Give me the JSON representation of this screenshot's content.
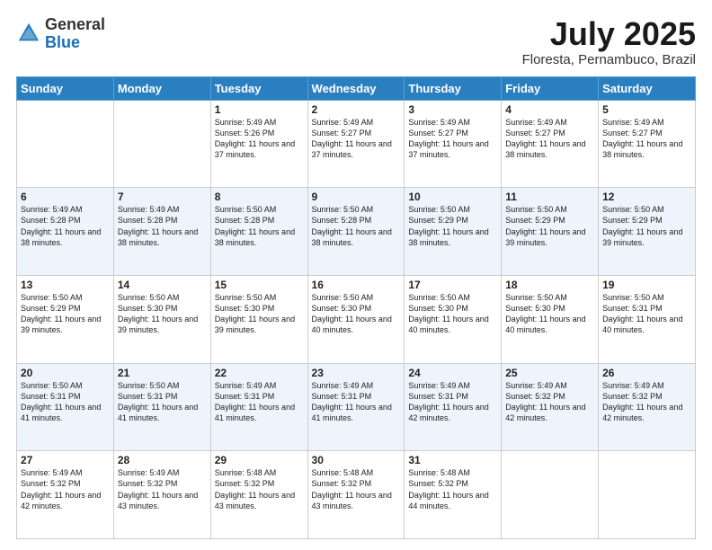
{
  "logo": {
    "general": "General",
    "blue": "Blue"
  },
  "header": {
    "title": "July 2025",
    "subtitle": "Floresta, Pernambuco, Brazil"
  },
  "days_of_week": [
    "Sunday",
    "Monday",
    "Tuesday",
    "Wednesday",
    "Thursday",
    "Friday",
    "Saturday"
  ],
  "weeks": [
    [
      {
        "day": "",
        "info": ""
      },
      {
        "day": "",
        "info": ""
      },
      {
        "day": "1",
        "info": "Sunrise: 5:49 AM\nSunset: 5:26 PM\nDaylight: 11 hours and 37 minutes."
      },
      {
        "day": "2",
        "info": "Sunrise: 5:49 AM\nSunset: 5:27 PM\nDaylight: 11 hours and 37 minutes."
      },
      {
        "day": "3",
        "info": "Sunrise: 5:49 AM\nSunset: 5:27 PM\nDaylight: 11 hours and 37 minutes."
      },
      {
        "day": "4",
        "info": "Sunrise: 5:49 AM\nSunset: 5:27 PM\nDaylight: 11 hours and 38 minutes."
      },
      {
        "day": "5",
        "info": "Sunrise: 5:49 AM\nSunset: 5:27 PM\nDaylight: 11 hours and 38 minutes."
      }
    ],
    [
      {
        "day": "6",
        "info": "Sunrise: 5:49 AM\nSunset: 5:28 PM\nDaylight: 11 hours and 38 minutes."
      },
      {
        "day": "7",
        "info": "Sunrise: 5:49 AM\nSunset: 5:28 PM\nDaylight: 11 hours and 38 minutes."
      },
      {
        "day": "8",
        "info": "Sunrise: 5:50 AM\nSunset: 5:28 PM\nDaylight: 11 hours and 38 minutes."
      },
      {
        "day": "9",
        "info": "Sunrise: 5:50 AM\nSunset: 5:28 PM\nDaylight: 11 hours and 38 minutes."
      },
      {
        "day": "10",
        "info": "Sunrise: 5:50 AM\nSunset: 5:29 PM\nDaylight: 11 hours and 38 minutes."
      },
      {
        "day": "11",
        "info": "Sunrise: 5:50 AM\nSunset: 5:29 PM\nDaylight: 11 hours and 39 minutes."
      },
      {
        "day": "12",
        "info": "Sunrise: 5:50 AM\nSunset: 5:29 PM\nDaylight: 11 hours and 39 minutes."
      }
    ],
    [
      {
        "day": "13",
        "info": "Sunrise: 5:50 AM\nSunset: 5:29 PM\nDaylight: 11 hours and 39 minutes."
      },
      {
        "day": "14",
        "info": "Sunrise: 5:50 AM\nSunset: 5:30 PM\nDaylight: 11 hours and 39 minutes."
      },
      {
        "day": "15",
        "info": "Sunrise: 5:50 AM\nSunset: 5:30 PM\nDaylight: 11 hours and 39 minutes."
      },
      {
        "day": "16",
        "info": "Sunrise: 5:50 AM\nSunset: 5:30 PM\nDaylight: 11 hours and 40 minutes."
      },
      {
        "day": "17",
        "info": "Sunrise: 5:50 AM\nSunset: 5:30 PM\nDaylight: 11 hours and 40 minutes."
      },
      {
        "day": "18",
        "info": "Sunrise: 5:50 AM\nSunset: 5:30 PM\nDaylight: 11 hours and 40 minutes."
      },
      {
        "day": "19",
        "info": "Sunrise: 5:50 AM\nSunset: 5:31 PM\nDaylight: 11 hours and 40 minutes."
      }
    ],
    [
      {
        "day": "20",
        "info": "Sunrise: 5:50 AM\nSunset: 5:31 PM\nDaylight: 11 hours and 41 minutes."
      },
      {
        "day": "21",
        "info": "Sunrise: 5:50 AM\nSunset: 5:31 PM\nDaylight: 11 hours and 41 minutes."
      },
      {
        "day": "22",
        "info": "Sunrise: 5:49 AM\nSunset: 5:31 PM\nDaylight: 11 hours and 41 minutes."
      },
      {
        "day": "23",
        "info": "Sunrise: 5:49 AM\nSunset: 5:31 PM\nDaylight: 11 hours and 41 minutes."
      },
      {
        "day": "24",
        "info": "Sunrise: 5:49 AM\nSunset: 5:31 PM\nDaylight: 11 hours and 42 minutes."
      },
      {
        "day": "25",
        "info": "Sunrise: 5:49 AM\nSunset: 5:32 PM\nDaylight: 11 hours and 42 minutes."
      },
      {
        "day": "26",
        "info": "Sunrise: 5:49 AM\nSunset: 5:32 PM\nDaylight: 11 hours and 42 minutes."
      }
    ],
    [
      {
        "day": "27",
        "info": "Sunrise: 5:49 AM\nSunset: 5:32 PM\nDaylight: 11 hours and 42 minutes."
      },
      {
        "day": "28",
        "info": "Sunrise: 5:49 AM\nSunset: 5:32 PM\nDaylight: 11 hours and 43 minutes."
      },
      {
        "day": "29",
        "info": "Sunrise: 5:48 AM\nSunset: 5:32 PM\nDaylight: 11 hours and 43 minutes."
      },
      {
        "day": "30",
        "info": "Sunrise: 5:48 AM\nSunset: 5:32 PM\nDaylight: 11 hours and 43 minutes."
      },
      {
        "day": "31",
        "info": "Sunrise: 5:48 AM\nSunset: 5:32 PM\nDaylight: 11 hours and 44 minutes."
      },
      {
        "day": "",
        "info": ""
      },
      {
        "day": "",
        "info": ""
      }
    ]
  ]
}
